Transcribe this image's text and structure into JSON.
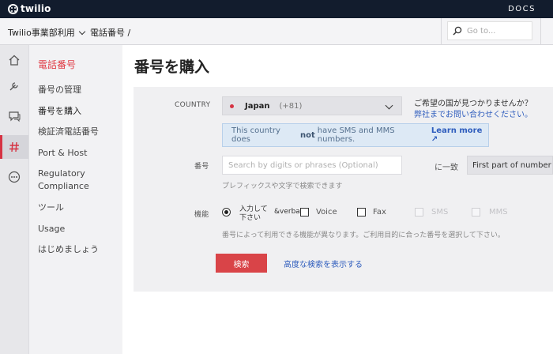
{
  "topbar": {
    "logo_text": "twilio",
    "docs_label": "DOCS"
  },
  "subbar": {
    "account_name": "Twilio事業部利用",
    "breadcrumb": "電話番号 /",
    "search_placeholder": "Go to..."
  },
  "rail": {
    "icons": [
      "home-icon",
      "tools-icon",
      "chat-icon",
      "hash-icon",
      "more-icon"
    ],
    "active_index": 3
  },
  "sidenav": {
    "title": "電話番号",
    "items": [
      {
        "label": "番号の管理"
      },
      {
        "label": "番号を購入"
      },
      {
        "label": "検証済電話番号"
      },
      {
        "label": "Port & Host"
      },
      {
        "label": "Regulatory Compliance"
      },
      {
        "label": "ツール"
      },
      {
        "label": "Usage"
      },
      {
        "label": "はじめましょう"
      }
    ]
  },
  "main": {
    "title": "番号を購入",
    "country": {
      "label": "COUNTRY",
      "name": "Japan",
      "code": "(+81)",
      "not_found": "ご希望の国が見つかりませんか？",
      "contact_link": "弊社までお問い合わせください。"
    },
    "info": {
      "prefix": "This country does",
      "bold": "not",
      "suffix": "have SMS and MMS numbers.",
      "link": "Learn more ↗"
    },
    "number": {
      "label": "番号",
      "placeholder": "Search by digits or phrases (Optional)",
      "match_label": "に一致",
      "match_value": "First part of number",
      "hint": "プレフィックスや文字で検索できます"
    },
    "capabilities": {
      "label": "機能",
      "radio_text": "入力して下さい",
      "verba": "&verba",
      "voice": "Voice",
      "fax": "Fax",
      "sms": "SMS",
      "mms": "MMS",
      "hint": "番号によって利用できる機能が異なります。ご利用目的に合った番号を選択して下さい。"
    },
    "search_button": "検索",
    "advanced_link": "高度な検索を表示する"
  }
}
